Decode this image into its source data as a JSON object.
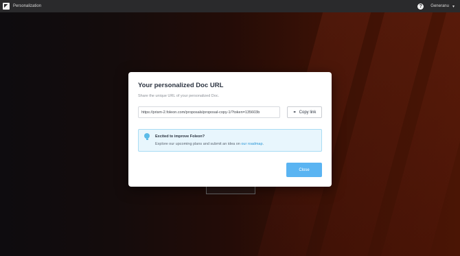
{
  "app": {
    "title": "Personalization"
  },
  "topbar": {
    "help_icon": "help-icon",
    "user_name": "Generanu",
    "chevron": "▾"
  },
  "modal": {
    "title": "Your personalized Doc URL",
    "subtitle": "Share the unique URL of your personalized Doc.",
    "url_value": "https://prism-2.foleon.com/proposals/proposal-copy-1/?token=135603b",
    "copy_label": "Copy link",
    "copy_icon": "link-icon",
    "banner": {
      "icon": "lightbulb-icon",
      "title": "Excited to improve Foleon?",
      "text_before": "Explore our upcoming plans and submit an idea on ",
      "link_text": "our roadmap",
      "text_after": "."
    },
    "close_label": "Close"
  },
  "colors": {
    "accent": "#5ab4f2",
    "banner_bg": "#e8f6fd",
    "banner_border": "#a8dcf4",
    "link": "#2a96d6"
  }
}
